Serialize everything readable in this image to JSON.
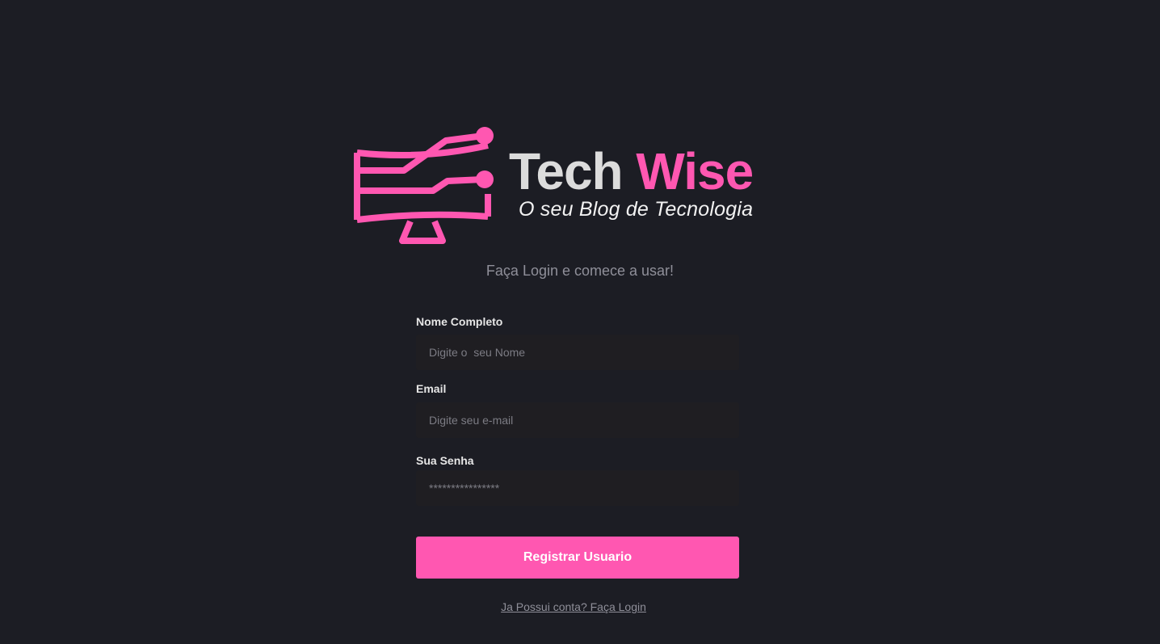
{
  "brand": {
    "title_part1": "Tech",
    "title_part2": "Wise",
    "tagline": "O seu Blog de Tecnologia",
    "logo_icon": "monitor-circuit-icon"
  },
  "subtitle": "Faça Login e comece a usar!",
  "form": {
    "name": {
      "label": "Nome Completo",
      "placeholder": "Digite o  seu Nome",
      "value": ""
    },
    "email": {
      "label": "Email",
      "placeholder": "Digite seu e-mail",
      "value": ""
    },
    "password": {
      "label": "Sua Senha",
      "placeholder": "****************",
      "value": ""
    },
    "submit_label": "Registrar Usuario"
  },
  "login_link": "Ja Possui conta? Faça Login",
  "colors": {
    "background": "#1c1d24",
    "accent": "#ff57b1",
    "input_background": "#1f1e22",
    "muted_text": "#8f8f99"
  }
}
